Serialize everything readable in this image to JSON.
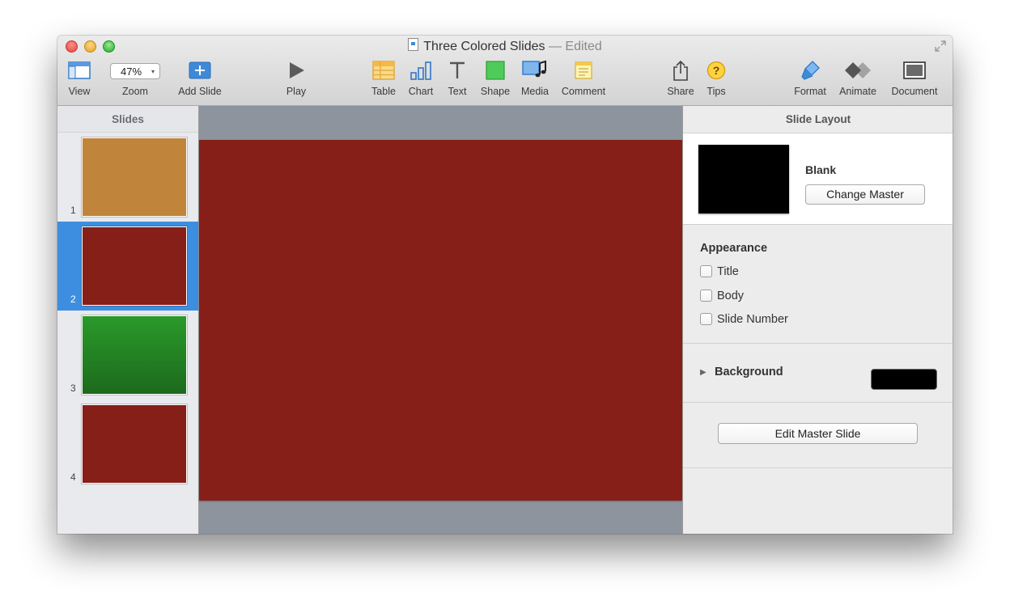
{
  "window": {
    "title": "Three Colored Slides",
    "separator": "—",
    "status": "Edited"
  },
  "toolbar": {
    "view_label": "View",
    "zoom_value": "47%",
    "zoom_label": "Zoom",
    "add_slide_label": "Add Slide",
    "play_label": "Play",
    "table_label": "Table",
    "chart_label": "Chart",
    "text_label": "Text",
    "shape_label": "Shape",
    "media_label": "Media",
    "comment_label": "Comment",
    "share_label": "Share",
    "tips_label": "Tips",
    "format_label": "Format",
    "animate_label": "Animate",
    "document_label": "Document",
    "icons": [
      "view-icon",
      "add-slide-icon",
      "play-icon",
      "table-icon",
      "chart-icon",
      "text-icon",
      "shape-icon",
      "media-icon",
      "comment-icon",
      "share-icon",
      "tips-icon",
      "format-icon",
      "animate-icon",
      "document-icon"
    ]
  },
  "sidebar": {
    "header": "Slides",
    "slides": [
      {
        "number": "1",
        "color": "#c0843a",
        "selected": false
      },
      {
        "number": "2",
        "color": "#861f18",
        "selected": true
      },
      {
        "number": "3",
        "color": "#1f7a1f",
        "selected": false
      },
      {
        "number": "4",
        "color": "#861f18",
        "selected": false
      }
    ]
  },
  "canvas": {
    "slide_color": "#861f18",
    "background": "#8d949e"
  },
  "inspector": {
    "header": "Slide Layout",
    "master_name": "Blank",
    "change_master_label": "Change Master",
    "appearance_title": "Appearance",
    "checkboxes": [
      {
        "label": "Title",
        "checked": false
      },
      {
        "label": "Body",
        "checked": false
      },
      {
        "label": "Slide Number",
        "checked": false
      }
    ],
    "background_label": "Background",
    "background_color": "#000000",
    "edit_master_label": "Edit Master Slide"
  },
  "colors": {
    "selection": "#3d8ee0",
    "accent": "#3f8ad8"
  }
}
